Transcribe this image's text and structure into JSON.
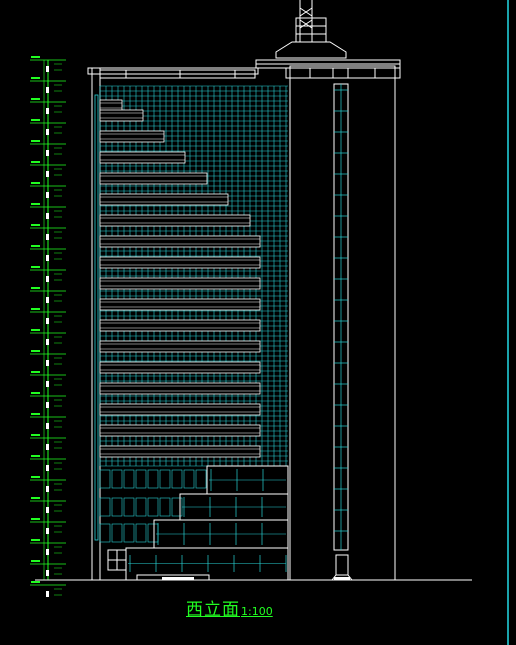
{
  "drawing": {
    "title": "西立面",
    "scale": "1:100",
    "colors": {
      "background": "#000000",
      "outline": "#ffffff",
      "glazing": "#29d3d6",
      "dimension": "#22ff22",
      "frame_edge": "#22d9e6"
    }
  }
}
